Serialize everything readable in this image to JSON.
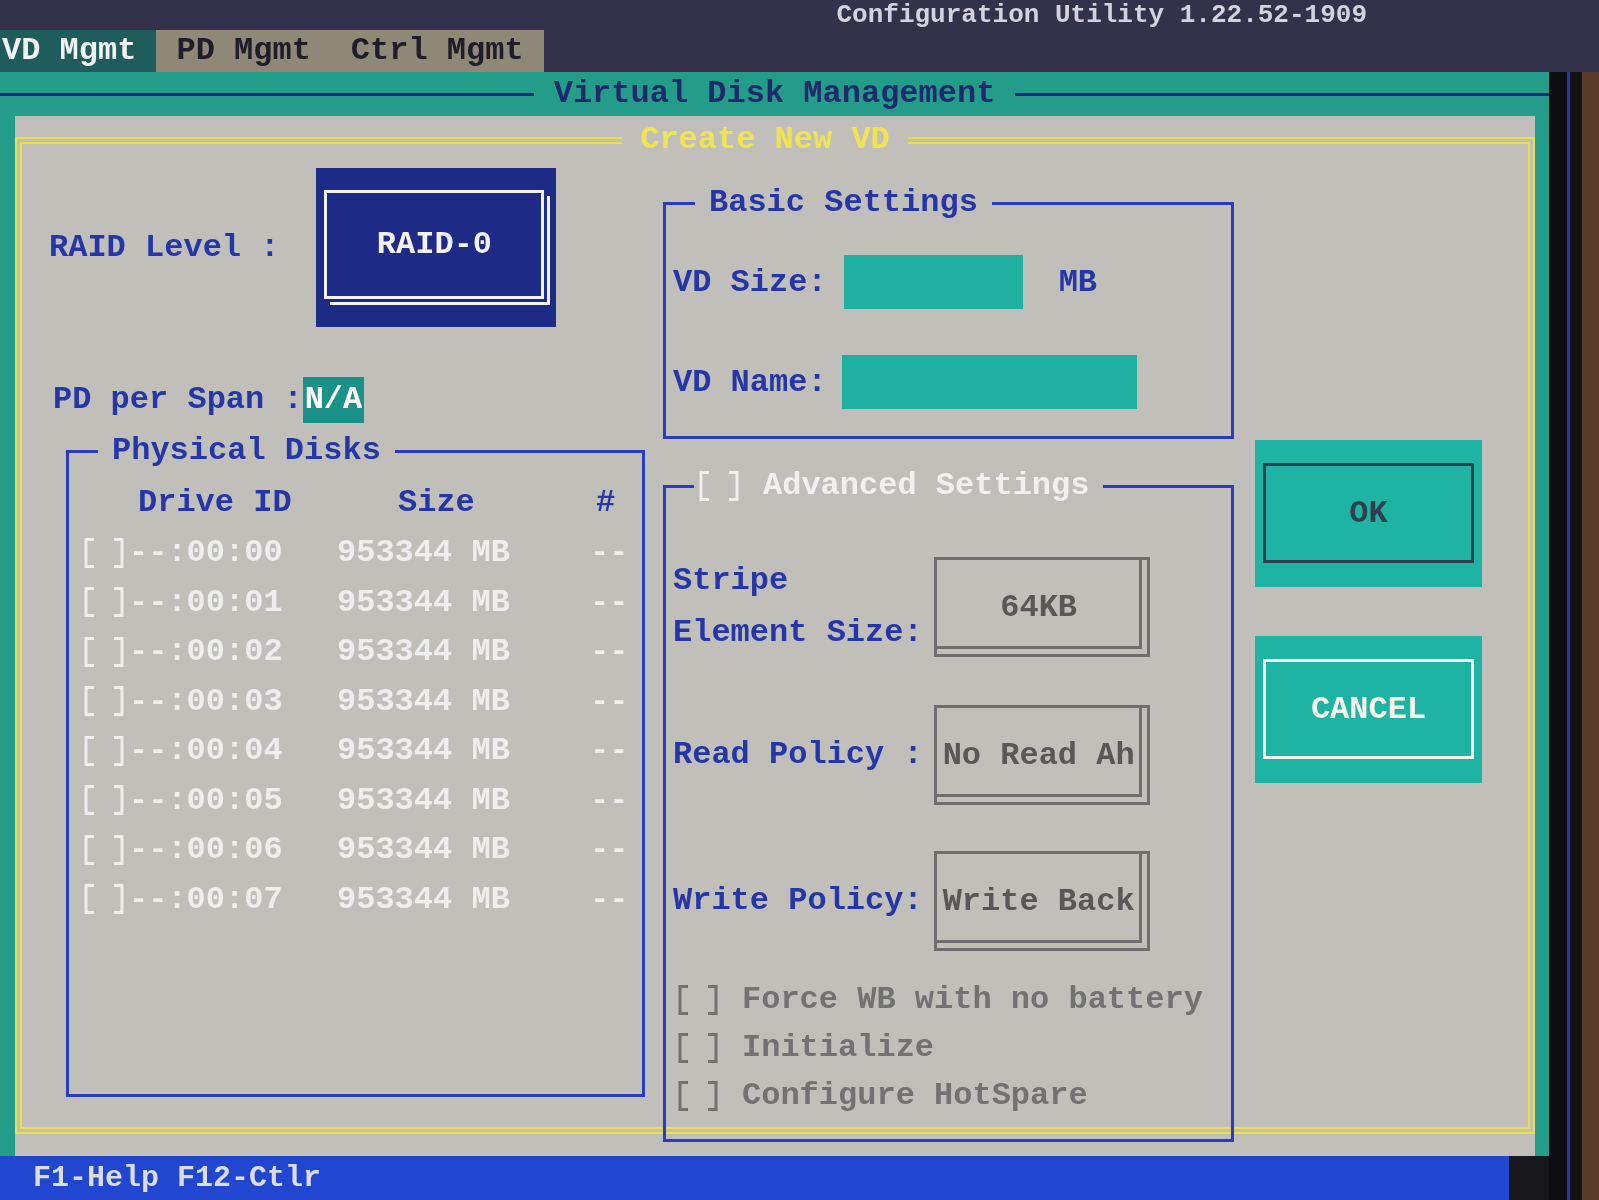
{
  "title_bar": {
    "title": "Configuration Utility 1.22.52-1909"
  },
  "menu": [
    {
      "label": "VD Mgmt",
      "selected": true
    },
    {
      "label": "PD Mgmt",
      "selected": false
    },
    {
      "label": "Ctrl Mgmt",
      "selected": false
    }
  ],
  "panel": {
    "title": "Virtual Disk Management"
  },
  "dialog": {
    "title": "Create New VD",
    "raid_level": {
      "label": "RAID Level :",
      "value": "RAID-0"
    },
    "pd_per_span": {
      "label": "PD per Span :",
      "value": "N/A"
    },
    "physical_disks": {
      "title": "Physical Disks",
      "columns": [
        "Drive ID",
        "Size",
        "#"
      ],
      "rows": [
        {
          "checked": false,
          "disabled": true,
          "drive_id": "--:00:00",
          "size": "953344 MB",
          "number": "--"
        },
        {
          "checked": false,
          "disabled": true,
          "drive_id": "--:00:01",
          "size": "953344 MB",
          "number": "--"
        },
        {
          "checked": false,
          "disabled": true,
          "drive_id": "--:00:02",
          "size": "953344 MB",
          "number": "--"
        },
        {
          "checked": false,
          "disabled": true,
          "drive_id": "--:00:03",
          "size": "953344 MB",
          "number": "--"
        },
        {
          "checked": false,
          "disabled": true,
          "drive_id": "--:00:04",
          "size": "953344 MB",
          "number": "--"
        },
        {
          "checked": false,
          "disabled": true,
          "drive_id": "--:00:05",
          "size": "953344 MB",
          "number": "--"
        },
        {
          "checked": false,
          "disabled": true,
          "drive_id": "--:00:06",
          "size": "953344 MB",
          "number": "--"
        },
        {
          "checked": false,
          "disabled": true,
          "drive_id": "--:00:07",
          "size": "953344 MB",
          "number": "--"
        }
      ]
    },
    "basic_settings": {
      "title": "Basic Settings",
      "vd_size": {
        "label": "VD Size:",
        "unit": "MB"
      },
      "vd_name": {
        "label": "VD Name:"
      }
    },
    "advanced_settings": {
      "title": "Advanced Settings",
      "checked": false,
      "settings": [
        {
          "label": "Stripe Element Size:",
          "value": "64KB",
          "disabled": true
        },
        {
          "label": "Read Policy :",
          "value": "No Read Ah",
          "disabled": true
        },
        {
          "label": "Write Policy:",
          "value": "Write Back",
          "disabled": true
        }
      ],
      "options": [
        {
          "label": "Force WB with no battery",
          "checked": false,
          "disabled": true
        },
        {
          "label": "Initialize",
          "checked": false,
          "disabled": true
        },
        {
          "label": "Configure HotSpare",
          "checked": false,
          "disabled": true
        }
      ]
    },
    "buttons": [
      {
        "label": "OK",
        "selected": false
      },
      {
        "label": "CANCEL",
        "selected": true
      }
    ]
  },
  "status_bar": {
    "text": "F1-Help F12-Ctlr"
  }
}
